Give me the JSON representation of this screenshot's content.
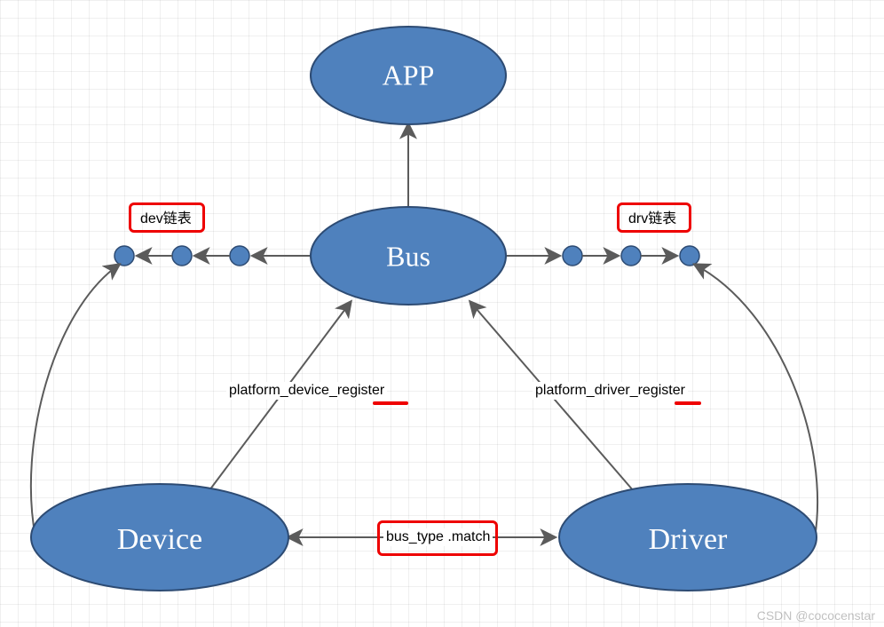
{
  "nodes": {
    "app": {
      "label": "APP"
    },
    "bus": {
      "label": "Bus"
    },
    "device": {
      "label": "Device"
    },
    "driver": {
      "label": "Driver"
    }
  },
  "labels": {
    "platform_device_register": "platform_device_register",
    "platform_driver_register": "platform_driver_register",
    "bus_type_match": "bus_type .match"
  },
  "annotations": {
    "dev_list": "dev链表",
    "drv_list": "drv链表"
  },
  "watermark": "CSDN @cococenstar"
}
